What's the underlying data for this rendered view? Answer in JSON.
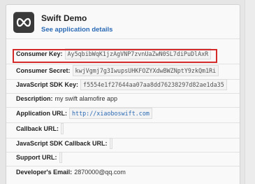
{
  "app": {
    "title": "Swift Demo",
    "details_link": "See application details",
    "icon": "infinity-icon"
  },
  "fields": [
    {
      "label": "Consumer Key:",
      "value": "Ay5qbibWqK1jzAgVNP7zvnUaZwN0SL7diPuDlAxR",
      "type": "code"
    },
    {
      "label": "Consumer Secret:",
      "value": "kwjVgmj7g3IwupsUHKFOZYXdwBWZNptY9zkQm1Ri",
      "type": "code"
    },
    {
      "label": "JavaScript SDK Key:",
      "value": "f5554e1f27644aa07aa8dd76238297d82ae1da35",
      "type": "code"
    },
    {
      "label": "Description:",
      "value": "my swift alamofire app",
      "type": "text"
    },
    {
      "label": "Application URL:",
      "value": "http://xiaoboswift.com",
      "type": "link"
    },
    {
      "label": "Callback URL:",
      "value": "",
      "type": "empty"
    },
    {
      "label": "JavaScript SDK Callback URL:",
      "value": "",
      "type": "empty"
    },
    {
      "label": "Support URL:",
      "value": "",
      "type": "empty"
    },
    {
      "label": "Developer's Email:",
      "value": "2870000@qq.com",
      "type": "text"
    }
  ],
  "colors": {
    "highlight": "#d42a2a",
    "link": "#2a6ab5"
  }
}
